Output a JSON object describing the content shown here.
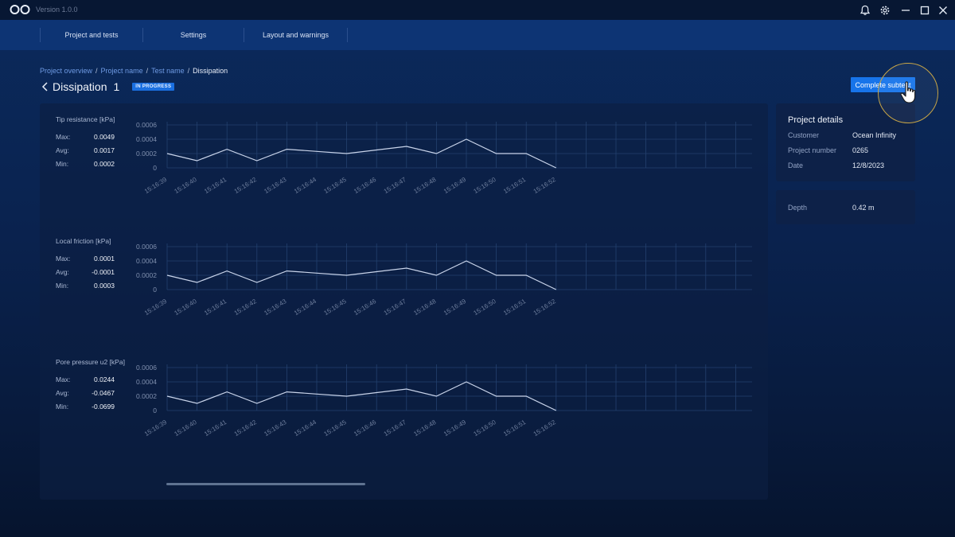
{
  "app": {
    "version": "Version 1.0.0",
    "icons": [
      "infinity-logo-icon",
      "bell-icon",
      "gear-icon",
      "minimize-icon",
      "maximize-icon",
      "close-icon"
    ]
  },
  "nav": {
    "items": [
      {
        "label": "Project and tests"
      },
      {
        "label": "Settings"
      },
      {
        "label": "Layout and warnings"
      }
    ]
  },
  "breadcrumb": {
    "items": [
      {
        "label": "Project overview"
      },
      {
        "label": "Project name"
      },
      {
        "label": "Test name"
      }
    ],
    "current": "Dissipation",
    "separator": "/"
  },
  "page": {
    "title": "Dissipation",
    "number": "1",
    "status": "IN PROGRESS",
    "complete_button": "Complete subtest"
  },
  "project_details": {
    "title": "Project details",
    "rows": [
      {
        "label": "Customer",
        "value": "Ocean Infinity"
      },
      {
        "label": "Project number",
        "value": "0265"
      },
      {
        "label": "Date",
        "value": "12/8/2023"
      }
    ]
  },
  "depth": {
    "label": "Depth",
    "value": "0.42 m"
  },
  "stats_labels": {
    "max": "Max:",
    "avg": "Avg:",
    "min": "Min:"
  },
  "colors": {
    "accent": "#1774ea",
    "line": "#c9d4ea",
    "grid": "#23406e",
    "badge": "#1a6fe0"
  },
  "chart_data": [
    {
      "type": "line",
      "title": "Tip resistance [kPa]",
      "stats": {
        "max": "0.0049",
        "avg": "0.0017",
        "min": "0.0002"
      },
      "x": [
        "15:16:39",
        "15:16:40",
        "15:16:41",
        "15:16:42",
        "15:16:43",
        "15:16:44",
        "15:16:45",
        "15:16:46",
        "15:16:47",
        "15:16:48",
        "15:16:49",
        "15:16:50",
        "15:16:51",
        "15:16:52"
      ],
      "values": [
        0.0002,
        0.0001,
        0.00026,
        0.0001,
        0.00026,
        0.00023,
        0.0002,
        0.00025,
        0.0003,
        0.0002,
        0.0004,
        0.0002,
        0.0002,
        0
      ],
      "y_ticks": [
        "0.0006",
        "0.0004",
        "0.0002",
        "0"
      ],
      "ylim": [
        0,
        0.0006
      ],
      "grid": true
    },
    {
      "type": "line",
      "title": "Local friction [kPa]",
      "stats": {
        "max": "0.0001",
        "avg": "-0.0001",
        "min": "0.0003"
      },
      "x": [
        "15:16:39",
        "15:16:40",
        "15:16:41",
        "15:16:42",
        "15:16:43",
        "15:16:44",
        "15:16:45",
        "15:16:46",
        "15:16:47",
        "15:16:48",
        "15:16:49",
        "15:16:50",
        "15:16:51",
        "15:16:52"
      ],
      "values": [
        0.0002,
        0.0001,
        0.00026,
        0.0001,
        0.00026,
        0.00023,
        0.0002,
        0.00025,
        0.0003,
        0.0002,
        0.0004,
        0.0002,
        0.0002,
        0
      ],
      "y_ticks": [
        "0.0006",
        "0.0004",
        "0.0002",
        "0"
      ],
      "ylim": [
        0,
        0.0006
      ],
      "grid": true
    },
    {
      "type": "line",
      "title": "Pore pressure u2 [kPa]",
      "stats": {
        "max": "0.0244",
        "avg": "-0.0467",
        "min": "-0.0699"
      },
      "x": [
        "15:16:39",
        "15:16:40",
        "15:16:41",
        "15:16:42",
        "15:16:43",
        "15:16:44",
        "15:16:45",
        "15:16:46",
        "15:16:47",
        "15:16:48",
        "15:16:49",
        "15:16:50",
        "15:16:51",
        "15:16:52"
      ],
      "values": [
        0.0002,
        0.0001,
        0.00026,
        0.0001,
        0.00026,
        0.00023,
        0.0002,
        0.00025,
        0.0003,
        0.0002,
        0.0004,
        0.0002,
        0.0002,
        0
      ],
      "y_ticks": [
        "0.0006",
        "0.0004",
        "0.0002",
        "0"
      ],
      "ylim": [
        0,
        0.0006
      ],
      "grid": true
    }
  ]
}
